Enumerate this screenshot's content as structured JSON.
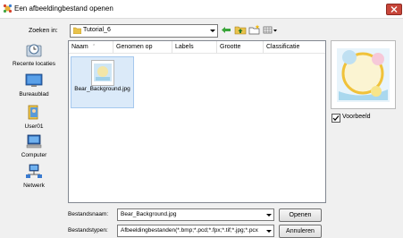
{
  "window": {
    "title": "Een afbeeldingbestand openen"
  },
  "toolbar": {
    "lookin_label": "Zoeken in:",
    "lookin_value": "Tutorial_6"
  },
  "places": [
    {
      "label": "Recente locaties",
      "icon": "recent-locations-icon"
    },
    {
      "label": "Bureaublad",
      "icon": "desktop-icon"
    },
    {
      "label": "User01",
      "icon": "user-folder-icon"
    },
    {
      "label": "Computer",
      "icon": "computer-icon"
    },
    {
      "label": "Netwerk",
      "icon": "network-icon"
    }
  ],
  "filelist": {
    "columns": [
      "Naam",
      "Genomen op",
      "Labels",
      "Grootte",
      "Classificatie"
    ],
    "files": [
      {
        "name": "Bear_Background.jpg",
        "selected": true
      }
    ]
  },
  "preview": {
    "checkbox_label": "Voorbeeld",
    "checked": true
  },
  "fields": {
    "filename_label": "Bestandsnaam:",
    "filename_value": "Bear_Background.jpg",
    "filetype_label": "Bestandstypen:",
    "filetype_value": "Afbeeldingbestanden(*.bmp;*.pcd;*.fpx;*.tif;*.jpg;*.pcx"
  },
  "buttons": {
    "open": "Openen",
    "cancel": "Annuleren"
  }
}
